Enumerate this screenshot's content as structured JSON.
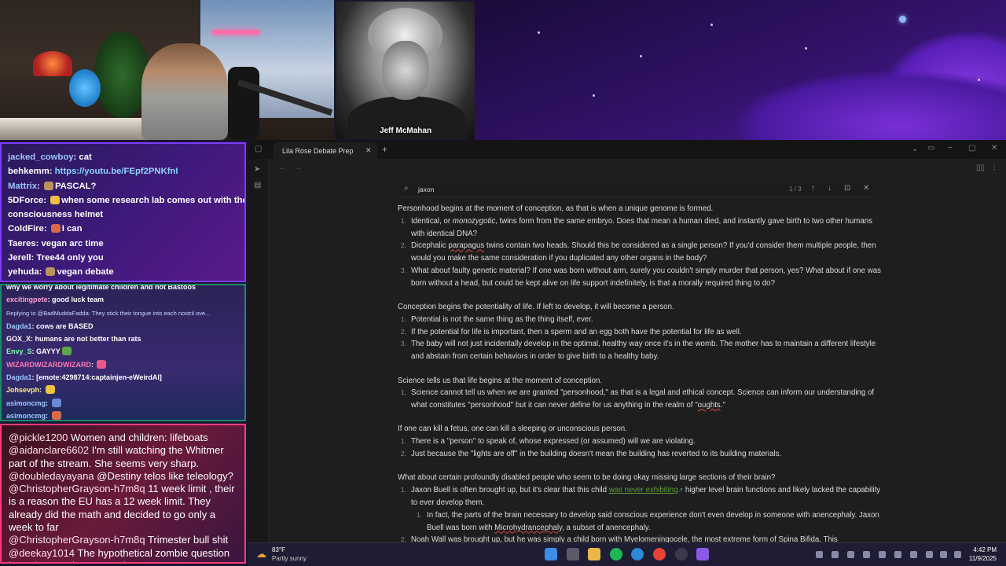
{
  "stream": {
    "guest_name": "Jeff McMahan"
  },
  "chat_top": [
    {
      "user": "jacked_cowboy",
      "user_color": "#9ec6ff",
      "text": "cat"
    },
    {
      "user": "behkemm",
      "user_color": "#ffffff",
      "link": "https://youtu.be/FEpf2PNKfnI",
      "text": ""
    },
    {
      "user": "Mattrix",
      "user_color": "#9ec6ff",
      "text": "PASCAL?"
    },
    {
      "user": "5DForce",
      "user_color": "#ffffff",
      "text": "when some research lab comes out with the"
    },
    {
      "user": "",
      "user_color": "#ffffff",
      "text": "consciousness helmet"
    },
    {
      "user": "ColdFire",
      "user_color": "#ffffff",
      "text": "I can"
    },
    {
      "user": "Taeres",
      "user_color": "#ffffff",
      "text": "vegan arc time"
    },
    {
      "user": "Jerell",
      "user_color": "#ffffff",
      "text": "Tree44 only you"
    },
    {
      "user": "yehuda",
      "user_color": "#ffffff",
      "text": "vegan debate"
    }
  ],
  "chat_mid": {
    "cut_line": "why we worry about legitimate children and not Bastoos",
    "lines": [
      {
        "user": "excitingpete",
        "user_color": "#ff9ed8",
        "text": "good luck team"
      },
      {
        "user": "",
        "user_color": "#cfd4ff",
        "text": "Replying to @BadMuddaFadda: They stick their tongue into each nostril ove...",
        "reply": true
      },
      {
        "user": "Dagda1",
        "user_color": "#9ec6ff",
        "text": "cows are BASED"
      },
      {
        "user": "GOX_X",
        "user_color": "#ffffff",
        "text": "humans are not better than rats"
      },
      {
        "user": "Envy_S",
        "user_color": "#7dffb0",
        "text": "GAYYY"
      },
      {
        "user": "WIZARDWIZARDWIZARD",
        "user_color": "#ff7ab0",
        "text": ""
      },
      {
        "user": "Dagda1",
        "user_color": "#9ec6ff",
        "text": "[emote:4298714:captainjen-eWeirdAl]"
      },
      {
        "user": "Johsevph",
        "user_color": "#fff27a",
        "text": ""
      },
      {
        "user": "asimoncmg",
        "user_color": "#9ec6ff",
        "text": ""
      },
      {
        "user": "asimoncmg",
        "user_color": "#9ec6ff",
        "text": ""
      }
    ]
  },
  "chat_bottom": [
    {
      "user": "@pickle1200",
      "text": "Women and children: lifeboats"
    },
    {
      "user": "@aidanclare6602",
      "text": "I'm still watching the Whitmer part of the stream. She seems very sharp."
    },
    {
      "user": "@doubledayayana",
      "text": "@Destiny telos like teleology?"
    },
    {
      "user": "@ChristopherGrayson-h7m8q",
      "text": "11 week limit , their is a reason the EU has a 12 week limit. They already did the math and decided to go only a week to far"
    },
    {
      "user": "@ChristopherGrayson-h7m8q",
      "text": "Trimester bull shit"
    },
    {
      "user": "@deekay1014",
      "text": "The hypothetical zombie question is such a good argument imo"
    }
  ],
  "app": {
    "tab_title": "Lila Rose Debate Prep",
    "search": {
      "query": "jaxon",
      "count": "1 / 3"
    }
  },
  "doc": {
    "s1": {
      "heading": "Personhood begins at the moment of conception, as that is when a unique genome is formed.",
      "items": [
        {
          "n": "1.",
          "pre": "Identical, or ",
          "em": "monozygotic",
          "post": ", twins form from the same embryo. Does that mean a human died, and instantly gave birth to two other humans with identical DNA?"
        },
        {
          "n": "2.",
          "pre": "Dicephalic ",
          "u": "parapagus",
          "post": " twins contain two heads. Should this be considered as a single person? If you'd consider them multiple people, then would you make the same consideration if you duplicated any other organs in the body?"
        },
        {
          "n": "3.",
          "text": "What about faulty genetic material? If one was born without arm, surely you couldn't simply murder that person, yes? What about if one was born without a head, but could be kept alive on life support indefinitely, is that a morally required thing to do?"
        }
      ]
    },
    "s2": {
      "heading": "Conception begins the potentiality of life. If left to develop, it will become a person.",
      "items": [
        {
          "n": "1.",
          "text": "Potential is not the same thing as the thing itself, ever."
        },
        {
          "n": "2.",
          "text": "If the potential for life is important, then a sperm and an egg both have the potential for life as well."
        },
        {
          "n": "3.",
          "text": "The baby will not just incidentally develop in the optimal, healthy way once it's in the womb. The mother has to maintain a different lifestyle and abstain from certain behaviors in order to give birth to a healthy baby."
        }
      ]
    },
    "s3": {
      "heading": "Science tells us that life begins at the moment of conception.",
      "items": [
        {
          "n": "1.",
          "pre": "Science cannot tell us when we are granted \"personhood,\" as that is a legal and ethical concept. Science can inform our understanding of what constitutes \"personhood\" but it can never define for us anything in the realm of \"",
          "u": "oughts",
          "post": ".\""
        }
      ]
    },
    "s4": {
      "heading": "If one can kill a fetus, one can kill a sleeping or unconscious person.",
      "items": [
        {
          "n": "1.",
          "text": "There is a \"person\" to speak of, whose expressed (or assumed) will we are violating."
        },
        {
          "n": "2.",
          "text": "Just because the \"lights are off\" in the building doesn't mean the building has reverted to its building materials."
        }
      ]
    },
    "s5": {
      "heading": "What about certain profoundly disabled people who seem to be doing okay missing large sections of their brain?",
      "item1": {
        "n": "1.",
        "pre": "Jaxon Buell is often brought up, but it's clear that this child ",
        "link": "was never exhibiting",
        "post": " higher level brain functions and likely lacked the capability to ever develop them."
      },
      "sub1": {
        "n": "1.",
        "pre": "In fact, the parts of the brain necessary to develop said conscious experience don't even develop in someone with anencephaly. Jaxon Buell was born with ",
        "u": "Microhydrancephaly",
        "post": ", a subset of anencephaly."
      },
      "item2": {
        "n": "2.",
        "text": "Noah Wall was brought up, but he was simply a child born with Myelomeningocele, the most extreme form of Spina Bifida. This"
      }
    }
  },
  "taskbar": {
    "weather_temp": "83°F",
    "weather_desc": "Partly sunny",
    "time": "4:42 PM",
    "date": "11/9/2025"
  },
  "colors": {
    "accent": "#7a3cff",
    "chat3_border": "#ff3c7a",
    "chat2_border": "#1c8a6a",
    "link_green": "#5a9b3a"
  }
}
